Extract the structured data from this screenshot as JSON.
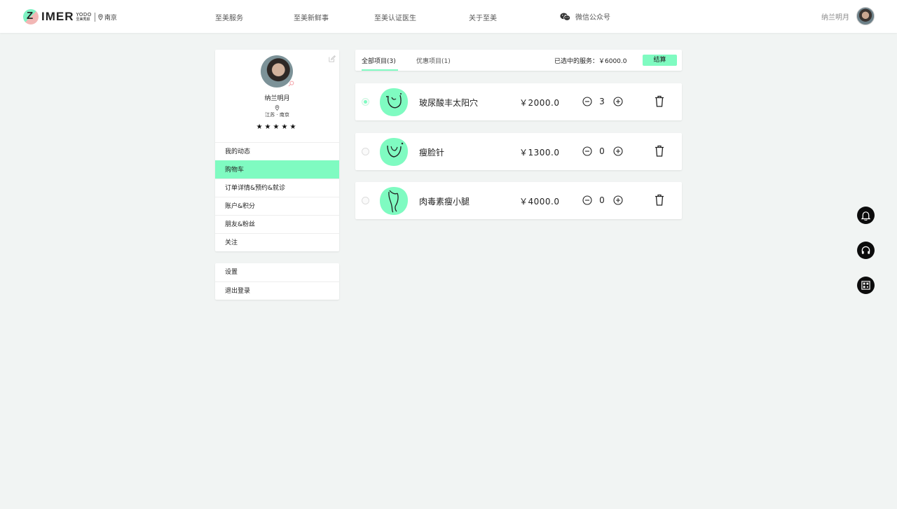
{
  "header": {
    "logo_text": "IMER",
    "logo_sub_en": "YODO",
    "logo_sub_cn": "至美秀颜",
    "city": "南京",
    "nav": [
      {
        "label": "至美服务"
      },
      {
        "label": "至美新鲜事"
      },
      {
        "label": "至美认证医生"
      },
      {
        "label": "关于至美"
      },
      {
        "label": "微信公众号",
        "icon": "wechat-icon"
      }
    ],
    "username": "纳兰明月"
  },
  "profile": {
    "name": "纳兰明月",
    "location": "江苏 · 南京",
    "stars": "★★★★★",
    "rating": 5
  },
  "menu": [
    {
      "label": "我的动态",
      "active": false
    },
    {
      "label": "购物车",
      "active": true
    },
    {
      "label": "订单详情&预约&就诊",
      "active": false
    },
    {
      "label": "账户&积分",
      "active": false
    },
    {
      "label": "朋友&粉丝",
      "active": false
    },
    {
      "label": "关注",
      "active": false
    }
  ],
  "settings_menu": [
    {
      "label": "设置"
    },
    {
      "label": "退出登录"
    }
  ],
  "cart": {
    "tabs": [
      {
        "label": "全部项目(3)",
        "active": true
      },
      {
        "label": "优惠项目(1)",
        "active": false
      }
    ],
    "selected_label": "已选中的服务：￥6000.0",
    "checkout_label": "结算",
    "items": [
      {
        "name": "玻尿酸丰太阳穴",
        "price": "￥2000.0",
        "qty": "3",
        "checked": true,
        "icon": "temple-icon"
      },
      {
        "name": "瘦脸针",
        "price": "￥1300.0",
        "qty": "0",
        "checked": false,
        "icon": "face-icon"
      },
      {
        "name": "肉毒素瘦小腿",
        "price": "￥4000.0",
        "qty": "0",
        "checked": false,
        "icon": "leg-icon"
      }
    ]
  },
  "floating": [
    {
      "icon": "bell-icon"
    },
    {
      "icon": "headset-icon"
    },
    {
      "icon": "qrcode-icon"
    }
  ],
  "colors": {
    "accent": "#7ffbc1",
    "background": "#f1f4f3",
    "card": "#ffffff",
    "float_button": "#0c0c0c"
  }
}
